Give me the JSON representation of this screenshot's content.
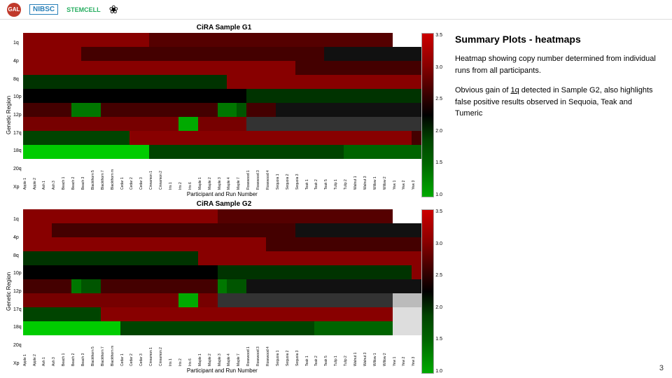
{
  "header": {
    "logo_text": "GAL",
    "nibsc_label": "NIBSC",
    "stemcell_label": "STEMCELL",
    "flower_icon": "❀"
  },
  "heatmap1": {
    "title": "CiRA Sample G1",
    "y_axis_label": "Genetic Region",
    "x_axis_label": "Participant and Run Number",
    "y_ticks": [
      "1q",
      "4p",
      "8q",
      "10p",
      "12p",
      "17q",
      "18q",
      "20q",
      "Xp"
    ],
    "colorbar_values": [
      "3.5",
      "3.0",
      "2.5",
      "2.0",
      "1.5",
      "1.0"
    ],
    "x_labels": [
      "Apple 1",
      "Apple 2",
      "Ash 1",
      "Ash 3",
      "Beach 1",
      "Beach 2",
      "Beach 3",
      "Blackthorn 5",
      "Blackthorn 7",
      "Blackthorn m",
      "Cedar 1",
      "Cedar 2",
      "Cedar 3",
      "Cinnamon 1",
      "Cinnamon 2",
      "Iris 1",
      "Iris 2",
      "Iris 6",
      "Maple 1",
      "Maple 2",
      "Maple 3",
      "Maple 4",
      "Maple 7",
      "Rosewood 1",
      "Rosewood 3",
      "Rosewood 4",
      "Sequoia 1",
      "Sequoia 2",
      "Sequoia 3",
      "Teak 1",
      "Teak 2",
      "Teak 5",
      "Tulip 1",
      "Tulip 2",
      "Walnut 1",
      "Walnut 3",
      "Willow 1",
      "Willow 2",
      "Yew 1",
      "Yew 2",
      "Yew 3"
    ]
  },
  "heatmap2": {
    "title": "CiRA Sample G2",
    "y_axis_label": "Genetic Region",
    "x_axis_label": "Participant and Run Number",
    "y_ticks": [
      "1q",
      "4p",
      "8q",
      "10p",
      "12p",
      "17q",
      "18q",
      "20q",
      "Xp"
    ],
    "colorbar_values": [
      "3.5",
      "3.0",
      "2.5",
      "2.0",
      "1.5",
      "1.0"
    ],
    "x_labels": [
      "Apple 1",
      "Apple 2",
      "Ash 1",
      "Ash 3",
      "Beach 1",
      "Beach 2",
      "Beach 3",
      "Blackthorn 5",
      "Blackthorn 7",
      "Blackthorn m",
      "Cedar 1",
      "Cedar 2",
      "Cedar 3",
      "Cinnamon 1",
      "Cinnamon 2",
      "Iris 1",
      "Iris 2",
      "Iris 6",
      "Maple 1",
      "Maple 2",
      "Maple 3",
      "Maple 4",
      "Maple 7",
      "Rosewood 1",
      "Rosewood 3",
      "Rosewood 4",
      "Sequoia 1",
      "Sequoia 2",
      "Sequoia 3",
      "Teak 1",
      "Teak 2",
      "Teak 5",
      "Tulip 1",
      "Tulip 2",
      "Walnut 1",
      "Walnut 3",
      "Willow 1",
      "Willow 2",
      "Yew 1",
      "Yew 2",
      "Yew 3"
    ]
  },
  "right_panel": {
    "title": "Summary Plots - heatmaps",
    "paragraph1": "Heatmap showing copy number determined from individual runs from all participants.",
    "paragraph2": "Obvious gain of 1q detected in Sample G2, also highlights false positive results observed in Sequoia, Teak and Tumeric"
  },
  "page_number": "3"
}
